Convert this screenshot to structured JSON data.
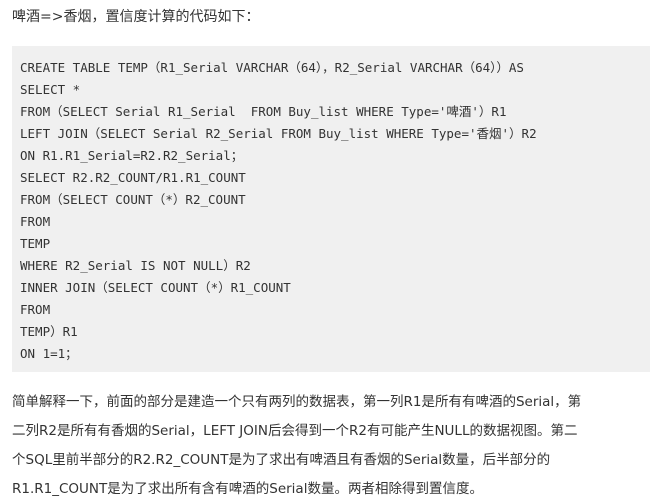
{
  "intro": "啤酒=>香烟，置信度计算的代码如下：",
  "code_lines": [
    "CREATE TABLE TEMP（R1_Serial VARCHAR（64），R2_Serial VARCHAR（64））AS",
    "SELECT *",
    "FROM（SELECT Serial R1_Serial  FROM Buy_list WHERE Type='啤酒'）R1",
    "LEFT JOIN（SELECT Serial R2_Serial FROM Buy_list WHERE Type='香烟'）R2",
    "ON R1.R1_Serial=R2.R2_Serial；",
    "SELECT R2.R2_COUNT/R1.R1_COUNT",
    "FROM（SELECT COUNT（*）R2_COUNT",
    "FROM",
    "TEMP",
    "WHERE R2_Serial IS NOT NULL）R2",
    "INNER JOIN（SELECT COUNT（*）R1_COUNT",
    "FROM",
    "TEMP）R1",
    "ON 1=1；"
  ],
  "explanation_lines": [
    "简单解释一下，前面的部分是建造一个只有两列的数据表，第一列R1是所有有啤酒的Serial，第",
    "二列R2是所有有香烟的Serial，LEFT JOIN后会得到一个R2有可能产生NULL的数据视图。第二",
    "个SQL里前半部分的R2.R2_COUNT是为了求出有啤酒且有香烟的Serial数量，后半部分的",
    "R1.R1_COUNT是为了求出所有含有啤酒的Serial数量。两者相除得到置信度。"
  ]
}
